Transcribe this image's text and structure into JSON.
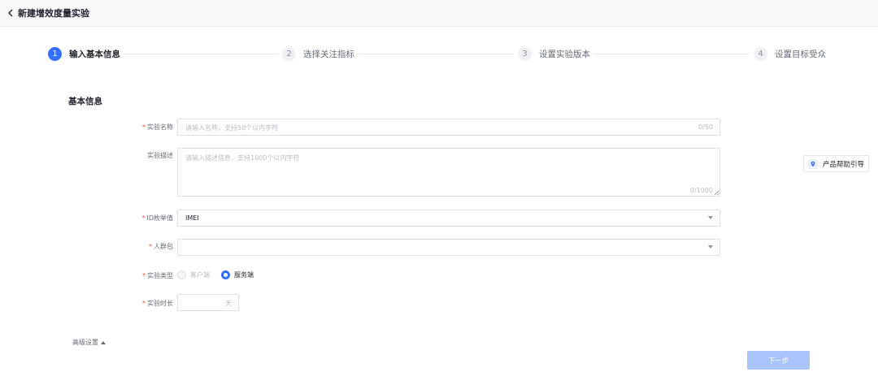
{
  "header": {
    "title": "新建增效度量实验",
    "back_icon": "chevron-left-icon"
  },
  "steps": [
    {
      "number": "1",
      "label": "输入基本信息",
      "state": "active"
    },
    {
      "number": "2",
      "label": "选择关注指标",
      "state": "inactive"
    },
    {
      "number": "3",
      "label": "设置实验版本",
      "state": "inactive"
    },
    {
      "number": "4",
      "label": "设置目标受众",
      "state": "inactive"
    }
  ],
  "section": {
    "title": "基本信息"
  },
  "form": {
    "name": {
      "required": "*",
      "label": "实验名称",
      "placeholder": "请输入名称，支持50个以内字符",
      "counter": "0/50"
    },
    "description": {
      "label": "实验描述",
      "placeholder": "请输入描述信息，支持1000个以内字符",
      "counter": "0/1000"
    },
    "id_type": {
      "required": "*",
      "label": "ID枚举值",
      "value": "IMEI"
    },
    "audience": {
      "required": "*",
      "label": "人群包",
      "value": ""
    },
    "type": {
      "required": "*",
      "label": "实验类型",
      "options": [
        {
          "label": "客户端",
          "checked": false,
          "disabled": true
        },
        {
          "label": "服务端",
          "checked": true,
          "disabled": false
        }
      ]
    },
    "duration": {
      "required": "*",
      "label": "实验时长",
      "value": "",
      "suffix": "天"
    }
  },
  "advanced": {
    "label": "高级设置"
  },
  "help": {
    "label": "产品帮助引导",
    "icon": "location-pin-icon"
  },
  "footer": {
    "next_label": "下一步"
  },
  "colors": {
    "primary": "#3370ff",
    "primary_disabled": "#a8c4fb",
    "required": "#f54a45"
  }
}
